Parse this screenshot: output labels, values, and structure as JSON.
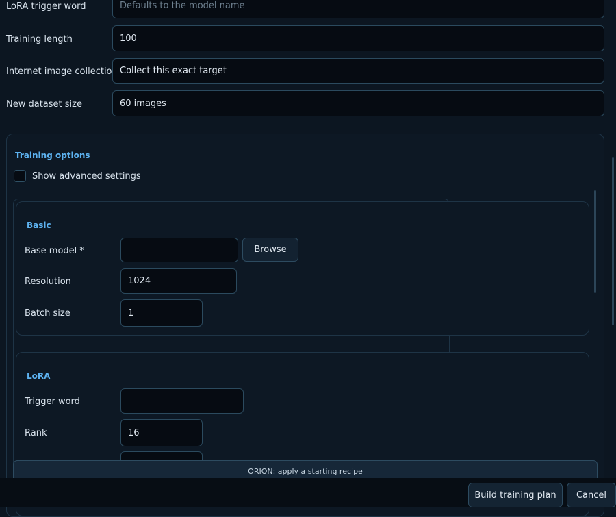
{
  "top_form": {
    "trigger_word": {
      "label": "LoRA trigger word",
      "value": "",
      "placeholder": "Defaults to the model name"
    },
    "training_length": {
      "label": "Training length",
      "value": "100"
    },
    "image_collection": {
      "label": "Internet image collection",
      "value": "Collect this exact target"
    },
    "dataset_size": {
      "label": "New dataset size",
      "value": "60 images"
    }
  },
  "training_options": {
    "title": "Training options",
    "advanced_label": "Show advanced settings",
    "basic": {
      "title": "Basic",
      "base_model": {
        "label": "Base model *",
        "value": ""
      },
      "browse_label": "Browse",
      "resolution": {
        "label": "Resolution",
        "value": "1024"
      },
      "batch_size": {
        "label": "Batch size",
        "value": "1"
      }
    },
    "lora": {
      "title": "LoRA",
      "trigger_word": {
        "label": "Trigger word",
        "value": ""
      },
      "rank": {
        "label": "Rank",
        "value": "16"
      }
    }
  },
  "orion_label": "ORION: apply a starting recipe",
  "footer": {
    "build_label": "Build training plan",
    "cancel_label": "Cancel"
  }
}
